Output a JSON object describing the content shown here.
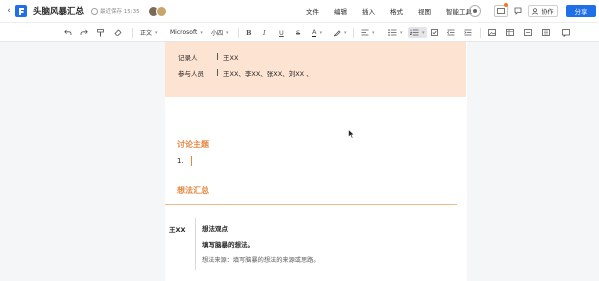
{
  "header": {
    "back_icon": "chevron-left-icon",
    "logo_icon": "doc-logo-icon",
    "title": "头脑风暴汇总",
    "save_status": "最近保存 15:35",
    "menu": [
      "文件",
      "编辑",
      "插入",
      "格式",
      "视图",
      "智能工具"
    ],
    "collab_label": "协作",
    "share_label": "分享",
    "accent": "#1f6fe8"
  },
  "toolbar": {
    "style_select": "正文",
    "font_select": "Microsoft",
    "size_select": "小四"
  },
  "document": {
    "info_rows": [
      {
        "label": "记录人",
        "value": "王XX"
      },
      {
        "label": "参与人员",
        "value": "王XX、李XX、张XX、刘XX 、"
      }
    ],
    "section1_title": "讨论主题",
    "list_item_number": "1.",
    "section2_title": "想法汇总",
    "idea_table": {
      "name": "王XX",
      "header": "想法观点",
      "body": "填写脑暴的想法。",
      "source": "想法来源：填写脑暴的想法的来源或思路。"
    },
    "accent": "#e5873f",
    "info_bg": "#fde3d1"
  }
}
